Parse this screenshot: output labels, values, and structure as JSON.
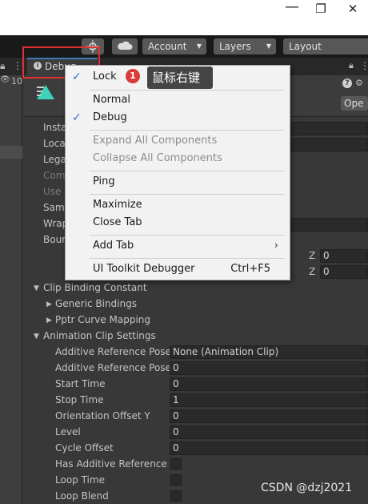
{
  "window": {
    "restore_glyph": "❐",
    "close_glyph": "✕"
  },
  "toolbar": {
    "account_label": "Account",
    "layers_label": "Layers",
    "layout_label": "Layout"
  },
  "tabs": {
    "debug_tab_label": "Debug",
    "left_count": "10"
  },
  "inspector": {
    "open_button": "Ope",
    "left_rows": [
      "Insta",
      "Loca",
      "Lega",
      "Com",
      "Use I",
      "Samp",
      "Wrap",
      "Boun"
    ],
    "z_label": "Z",
    "z_values": [
      "0",
      "0"
    ],
    "sections": [
      {
        "label": "Clip Binding Constant",
        "expanded": true
      },
      {
        "label": "Generic Bindings",
        "expanded": false
      },
      {
        "label": "Pptr Curve Mapping",
        "expanded": false
      },
      {
        "label": "Animation Clip Settings",
        "expanded": true
      }
    ],
    "settings": [
      {
        "label": "Additive Reference Pose",
        "value": "None (Animation Clip)"
      },
      {
        "label": "Additive Reference Pose",
        "value": "0"
      },
      {
        "label": "Start Time",
        "value": "0"
      },
      {
        "label": "Stop Time",
        "value": "1"
      },
      {
        "label": "Orientation Offset Y",
        "value": "0"
      },
      {
        "label": "Level",
        "value": "0"
      },
      {
        "label": "Cycle Offset",
        "value": "0"
      },
      {
        "label": "Has Additive Reference P",
        "value": ""
      },
      {
        "label": "Loop Time",
        "value": ""
      },
      {
        "label": "Loop Blend",
        "value": ""
      }
    ]
  },
  "menu": {
    "items": [
      {
        "label": "Lock",
        "checked": true,
        "disabled": false
      },
      {
        "label": "Normal",
        "checked": false,
        "disabled": false
      },
      {
        "label": "Debug",
        "checked": true,
        "disabled": false
      },
      {
        "label": "Expand All Components",
        "checked": false,
        "disabled": true
      },
      {
        "label": "Collapse All Components",
        "checked": false,
        "disabled": true
      },
      {
        "label": "Ping",
        "checked": false,
        "disabled": false
      },
      {
        "label": "Maximize",
        "checked": false,
        "disabled": false
      },
      {
        "label": "Close Tab",
        "checked": false,
        "disabled": false
      },
      {
        "label": "Add Tab",
        "checked": false,
        "disabled": false,
        "submenu": true
      },
      {
        "label": "UI Toolkit Debugger",
        "checked": false,
        "disabled": false,
        "shortcut": "Ctrl+F5"
      }
    ],
    "check_glyph": "✓",
    "submenu_glyph": "›"
  },
  "annotation": {
    "badge": "1",
    "text": "鼠标右键"
  },
  "watermark": "CSDN @dzj2021",
  "colors": {
    "accent": "#3a79bb",
    "highlight_box": "#e03232",
    "menu_check": "#2e72d2"
  }
}
